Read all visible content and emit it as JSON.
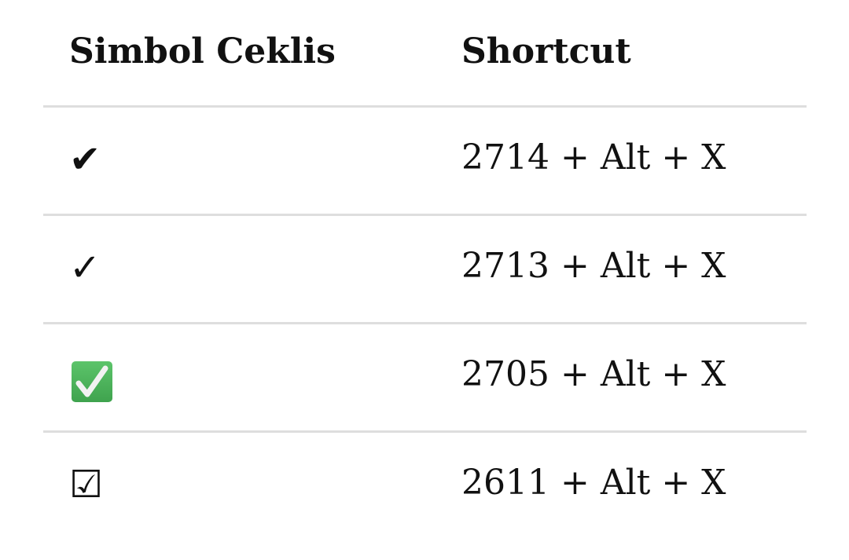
{
  "table": {
    "headers": [
      "Simbol Ceklis",
      "Shortcut"
    ],
    "rows": [
      {
        "symbol": "✔",
        "shortcut": "2714 + Alt + X"
      },
      {
        "symbol": "✓",
        "shortcut": "2713 + Alt + X"
      },
      {
        "symbol": "✅",
        "shortcut": "2705 + Alt + X",
        "icon": "green-check-box-icon",
        "color": "#4cb55a"
      },
      {
        "symbol": "☑",
        "shortcut": "2611 + Alt + X"
      }
    ]
  }
}
